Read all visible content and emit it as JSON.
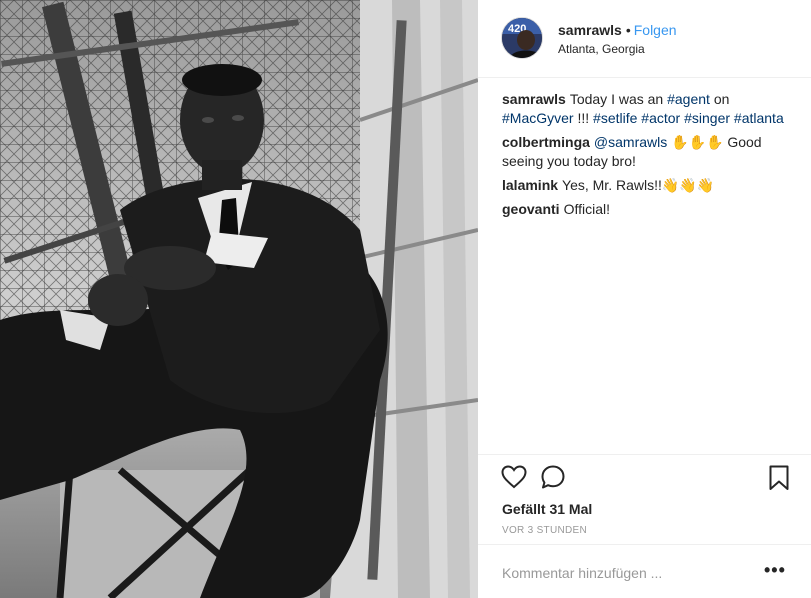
{
  "post": {
    "username": "samrawls",
    "separator": "•",
    "follow_label": "Folgen",
    "location": "Atlanta, Georgia",
    "avatar_badge": "420"
  },
  "caption": {
    "username": "samrawls",
    "parts": [
      {
        "text": "Today I was an ",
        "tag": false
      },
      {
        "text": "#agent",
        "tag": true
      },
      {
        "text": " on ",
        "tag": false
      },
      {
        "text": "#MacGyver",
        "tag": true
      },
      {
        "text": " !!! ",
        "tag": false
      },
      {
        "text": "#setlife",
        "tag": true
      },
      {
        "text": " ",
        "tag": false
      },
      {
        "text": "#actor",
        "tag": true
      },
      {
        "text": " ",
        "tag": false
      },
      {
        "text": "#singer",
        "tag": true
      },
      {
        "text": " ",
        "tag": false
      },
      {
        "text": "#atlanta",
        "tag": true
      }
    ]
  },
  "comments": [
    {
      "username": "colbertminga",
      "mention": "@samrawls",
      "emoji": "✋✋✋",
      "text": " Good seeing you today bro!"
    },
    {
      "username": "lalamink",
      "text": "Yes, Mr. Rawls!!",
      "emoji": "👋👋👋"
    },
    {
      "username": "geovanti",
      "text": "Official!"
    }
  ],
  "actions": {
    "like_icon": "heart-icon",
    "comment_icon": "comment-bubble-icon",
    "save_icon": "bookmark-icon"
  },
  "likes_text": "Gefällt 31 Mal",
  "time_ago": "VOR 3 STUNDEN",
  "comment_box": {
    "placeholder": "Kommentar hinzufügen ...",
    "more_label": "•••"
  },
  "colors": {
    "link": "#3897f0",
    "hashtag": "#003569",
    "text": "#262626",
    "muted": "#999999",
    "divider": "#efefef"
  }
}
